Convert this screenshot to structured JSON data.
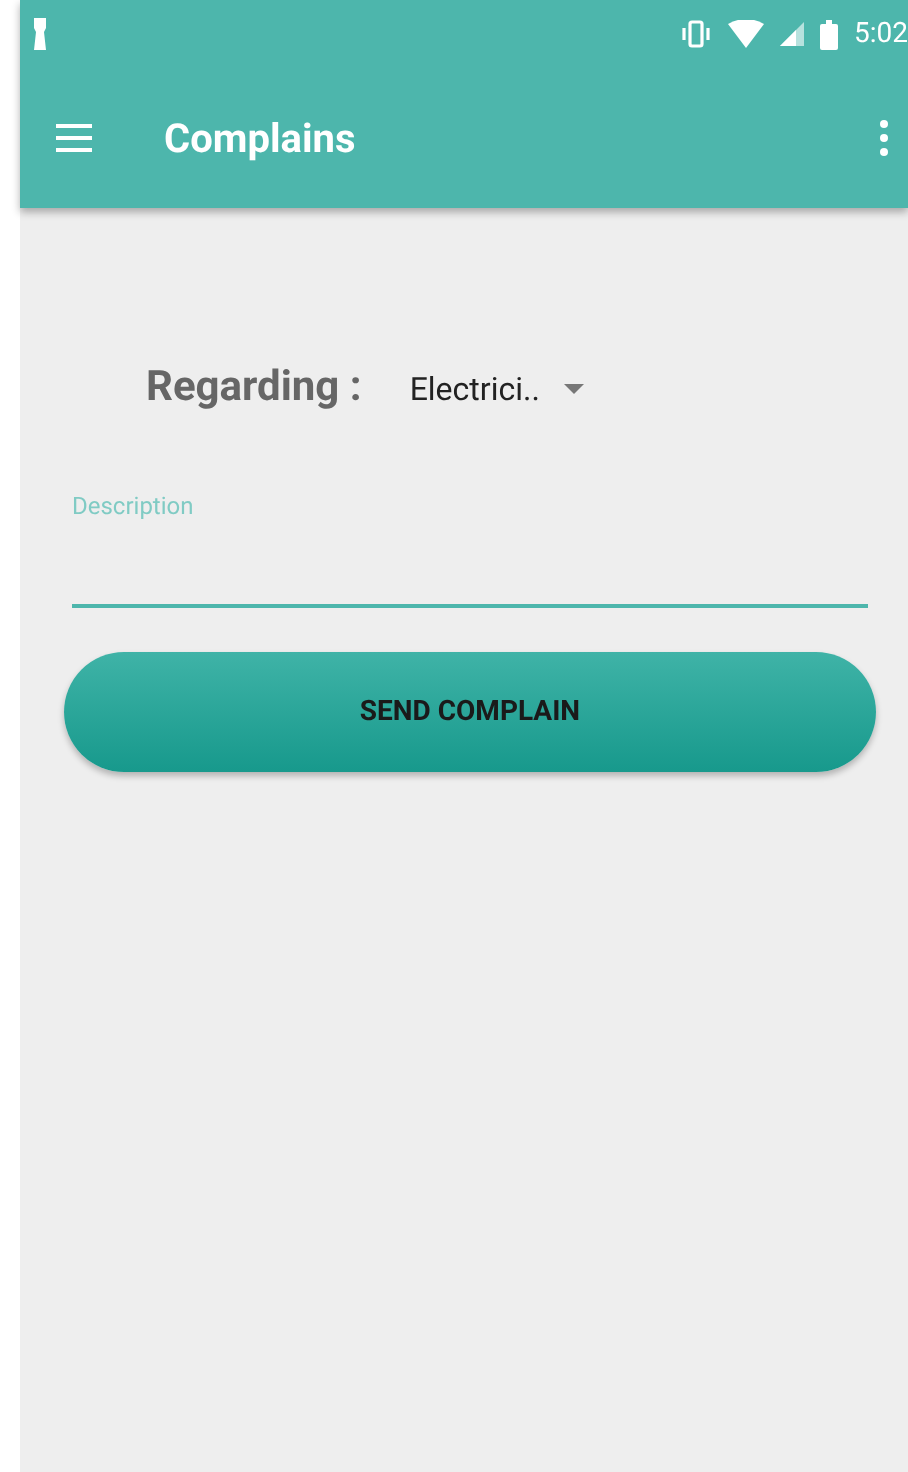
{
  "status_bar": {
    "time": "5:02"
  },
  "app_bar": {
    "title": "Complains"
  },
  "form": {
    "regarding_label": "Regarding :",
    "regarding_value": "Electrici..",
    "description": {
      "label": "Description",
      "focused": true
    },
    "submit_button": "SEND COMPLAIN"
  }
}
